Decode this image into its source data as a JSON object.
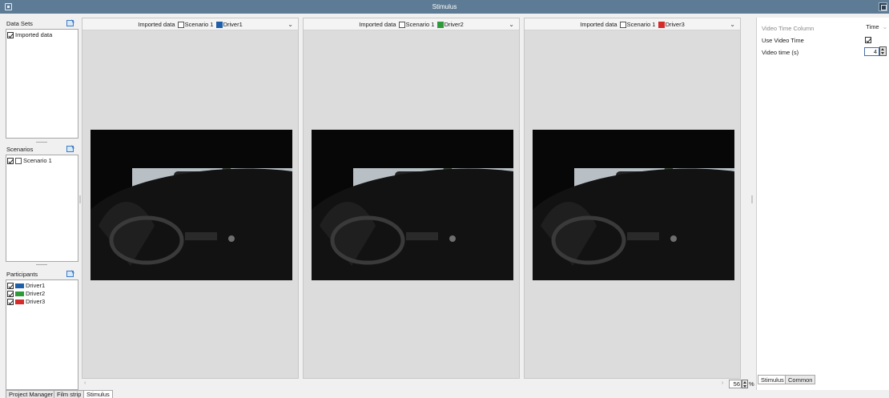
{
  "window": {
    "title": "Stimulus"
  },
  "left": {
    "datasets": {
      "label": "Data Sets",
      "items": [
        {
          "label": "Imported data",
          "checked": true
        }
      ]
    },
    "scenarios": {
      "label": "Scenarios",
      "items": [
        {
          "label": "Scenario 1",
          "checked": true
        }
      ]
    },
    "participants": {
      "label": "Participants",
      "items": [
        {
          "label": "Driver1",
          "checked": true,
          "color": "#1f5fa8"
        },
        {
          "label": "Driver2",
          "checked": true,
          "color": "#2e9a3a"
        },
        {
          "label": "Driver3",
          "checked": true,
          "color": "#d42b2b"
        }
      ]
    }
  },
  "panes": [
    {
      "dataset": "Imported data",
      "scenario": "Scenario 1",
      "driver": "Driver1",
      "color": "#1f5fa8"
    },
    {
      "dataset": "Imported data",
      "scenario": "Scenario 1",
      "driver": "Driver2",
      "color": "#2e9a3a"
    },
    {
      "dataset": "Imported data",
      "scenario": "Scenario 1",
      "driver": "Driver3",
      "color": "#d42b2b"
    }
  ],
  "zoom": {
    "value": "56",
    "unit": "%"
  },
  "right": {
    "video_time_column": {
      "label": "Video Time Column",
      "value": "Time"
    },
    "use_video_time": {
      "label": "Use Video Time",
      "checked": true
    },
    "video_time": {
      "label": "Video time (s)",
      "value": "4"
    },
    "tabs": [
      "Stimulus",
      "Common"
    ]
  },
  "bottom_tabs": [
    "Project Manager",
    "Film strip",
    "Stimulus"
  ]
}
